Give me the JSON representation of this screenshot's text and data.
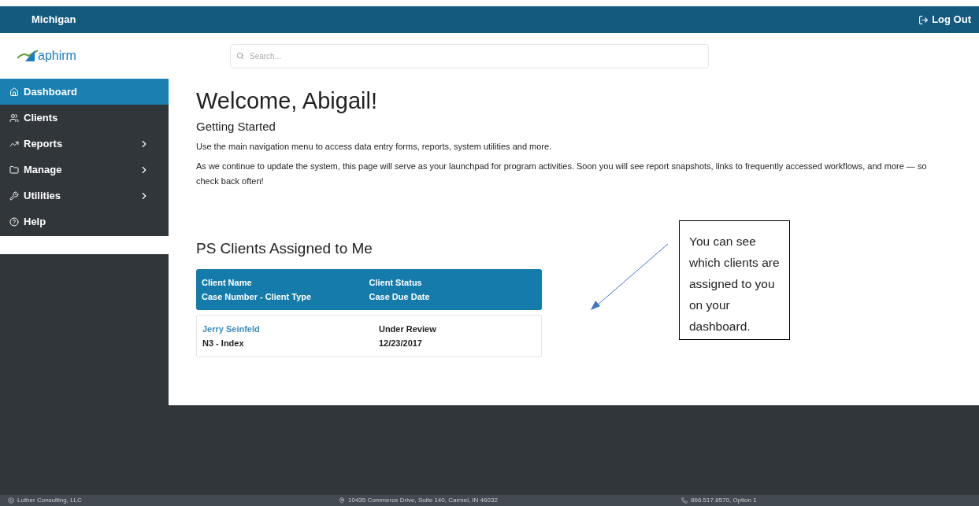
{
  "top_bar": {
    "state": "Michigan",
    "logout": "Log Out"
  },
  "logo": {
    "text": "aphirm"
  },
  "search": {
    "placeholder": "Search..."
  },
  "sidebar": {
    "items": [
      {
        "label": "Dashboard",
        "kind": "home",
        "submenu": false,
        "selected": true
      },
      {
        "label": "Clients",
        "kind": "users",
        "submenu": false,
        "selected": false
      },
      {
        "label": "Reports",
        "kind": "chart",
        "submenu": true,
        "selected": false
      },
      {
        "label": "Manage",
        "kind": "folder",
        "submenu": true,
        "selected": false
      },
      {
        "label": "Utilities",
        "kind": "tools",
        "submenu": true,
        "selected": false
      },
      {
        "label": "Help",
        "kind": "help",
        "submenu": false,
        "selected": false
      }
    ]
  },
  "main": {
    "title": "Welcome, Abigail!",
    "subtitle": "Getting Started",
    "paragraphs": [
      "Use the main navigation menu to access data entry forms, reports, system utilities and more.",
      "As we continue to update the system, this page will serve as your launchpad for program activities. Soon you will see report snapshots, links to frequently accessed workflows, and more — so check back often!"
    ]
  },
  "clients": {
    "title": "PS Clients Assigned to Me",
    "columns": [
      [
        "Client Name",
        "Case Number - Client Type"
      ],
      [
        "Client Status",
        "Case Due Date"
      ]
    ],
    "rows": [
      {
        "name": "Jerry Seinfeld",
        "case": "N3 - Index",
        "status": "Under Review",
        "due": "12/23/2017"
      }
    ]
  },
  "callout": {
    "text": "You can see which clients are assigned to you on your dashboard."
  },
  "footer": {
    "company": "Luther Consulting, LLC",
    "address": "10435 Commerce Drive, Suite 140, Carmel, IN 46032",
    "phone": "866.517.6570, Option 1"
  }
}
